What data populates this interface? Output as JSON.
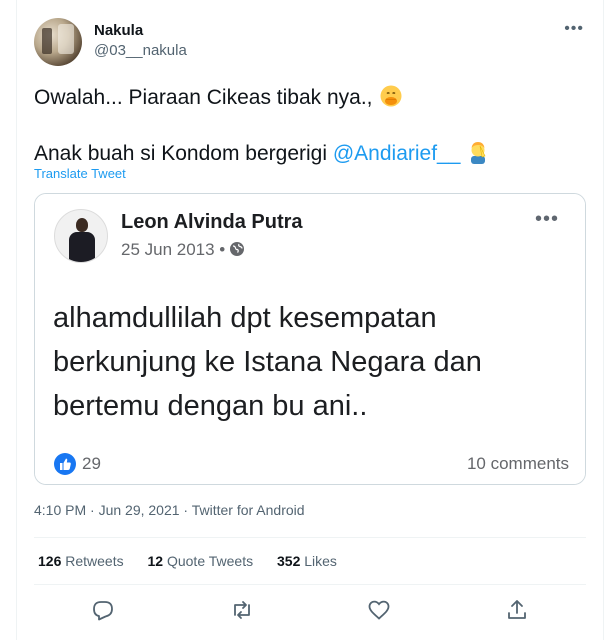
{
  "tweet": {
    "author": {
      "display_name": "Nakula",
      "handle": "@03__nakula"
    },
    "text_line1": "Owalah... Piaraan Cikeas tibak nya.,",
    "text_line2_prefix": "Anak buah si Kondom bergerigi ",
    "mention": "@Andiarief__",
    "translate_label": "Translate Tweet",
    "timestamp": "4:10 PM · Jun 29, 2021 · Twitter for Android",
    "emoji_1": "face-with-hand-over-mouth",
    "emoji_2": "person-facepalming"
  },
  "quoted_post": {
    "name": "Leon Alvinda Putra",
    "date": "25 Jun 2013 •",
    "body": "alhamdullilah dpt kesempatan berkunjung ke Istana Negara dan bertemu dengan bu ani..",
    "like_count": "29",
    "comments": "10 comments"
  },
  "stats": {
    "retweets_count": "126",
    "retweets_label": "Retweets",
    "quotes_count": "12",
    "quotes_label": "Quote Tweets",
    "likes_count": "352",
    "likes_label": "Likes"
  },
  "colors": {
    "link": "#1d9bf0",
    "text": "#0f1419",
    "secondary": "#536471",
    "facebook_blue": "#1877f2"
  },
  "icons": [
    "more-icon",
    "reply-icon",
    "retweet-icon",
    "like-icon",
    "share-icon",
    "globe-icon",
    "facebook-like-icon"
  ]
}
